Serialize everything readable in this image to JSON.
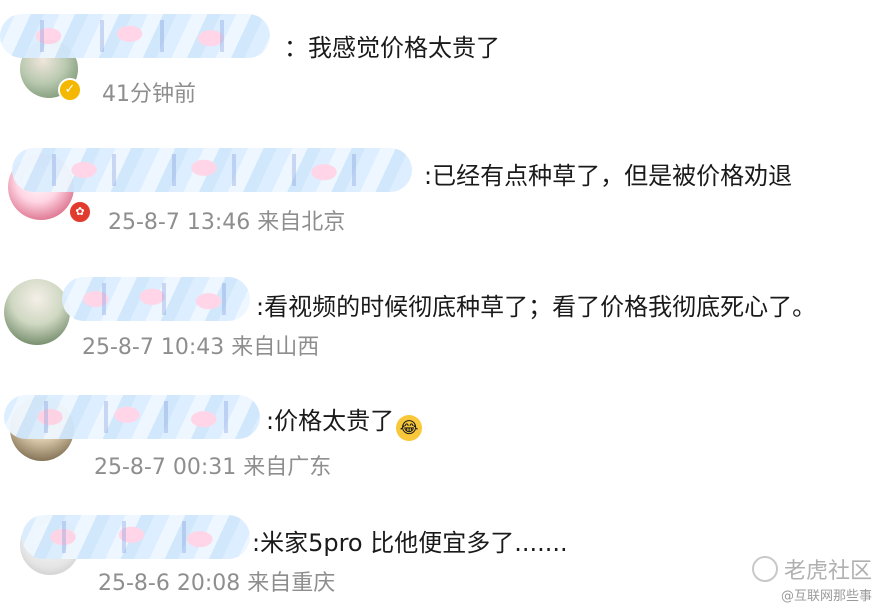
{
  "comments": [
    {
      "text": "：我感觉价格太贵了",
      "meta": "41分钟前",
      "badge": "✓"
    },
    {
      "text": ":已经有点种草了，但是被价格劝退",
      "meta": "25-8-7 13:46 来自北京",
      "badge": "✿"
    },
    {
      "text": ":看视频的时候彻底种草了；看了价格我彻底死心了。",
      "meta": "25-8-7 10:43 来自山西"
    },
    {
      "text": ":价格太贵了",
      "meta": "25-8-7 00:31 来自广东",
      "emoji": "😂"
    },
    {
      "text": ":米家5pro 比他便宜多了.......",
      "meta": "25-8-6 20:08 来自重庆"
    }
  ],
  "watermark": {
    "title": "老虎社区",
    "sub": "@互联网那些事"
  }
}
